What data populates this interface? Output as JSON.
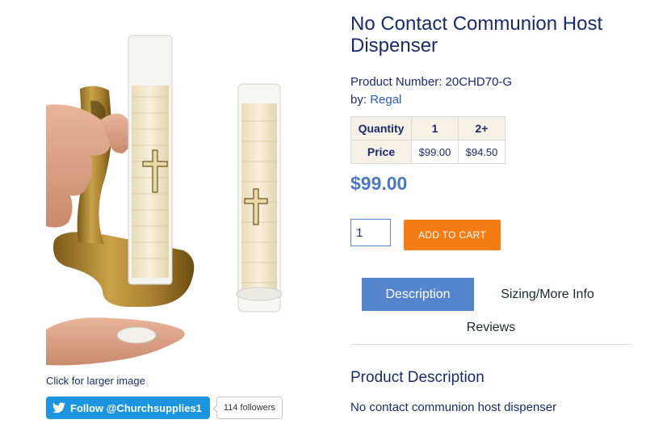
{
  "product": {
    "title": "No Contact Communion Host Dispenser",
    "number_label": "Product Number: 20CHD70-G",
    "by_prefix": "by: ",
    "brand": "Regal",
    "current_price": "$99.00"
  },
  "image": {
    "larger_link": "Click for larger image"
  },
  "social": {
    "follow_label": "Follow @Churchsupplies1",
    "followers": "114 followers"
  },
  "pricing_table": {
    "headers": [
      "Quantity",
      "1",
      "2+"
    ],
    "row_label": "Price",
    "prices": [
      "$99.00",
      "$94.50"
    ]
  },
  "cart": {
    "quantity_value": "1",
    "add_label": "ADD TO CART"
  },
  "tabs": {
    "description": "Description",
    "sizing": "Sizing/More Info",
    "reviews": "Reviews"
  },
  "description": {
    "heading": "Product Description",
    "text": "No contact communion host dispenser"
  },
  "colors": {
    "accent": "#4a78c2",
    "add_to_cart": "#f47c14",
    "active_tab": "#5486cf",
    "text": "#1a2a6c",
    "twitter": "#1b95e0"
  }
}
